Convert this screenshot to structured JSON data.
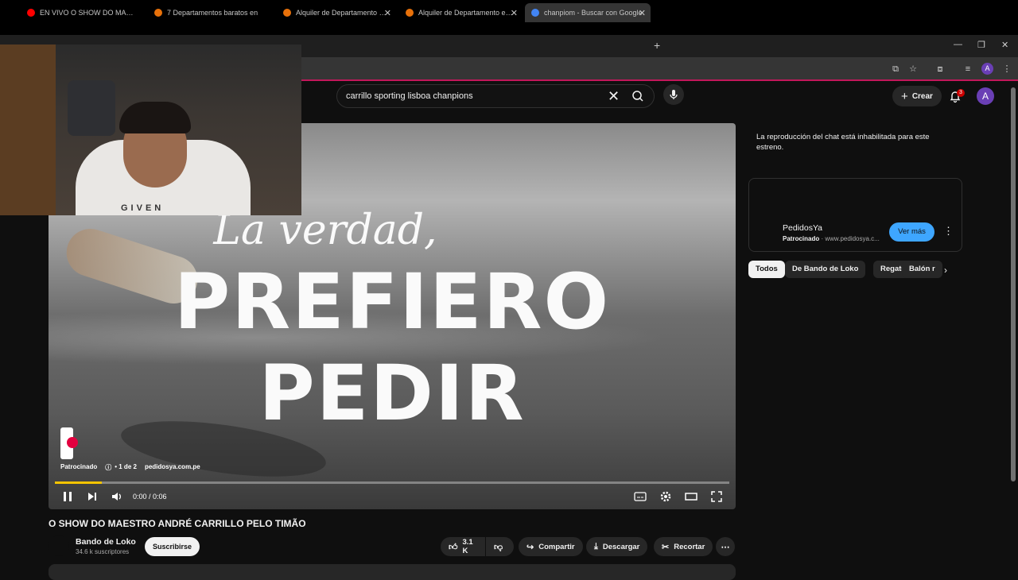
{
  "browser": {
    "tabs": [
      {
        "label": "EN VIVO O SHOW DO MAESTRO",
        "favicon_color": "#ff0000"
      },
      {
        "label": "7 Departamentos baratos en",
        "favicon_color": "#e8710a"
      },
      {
        "label": "Alquiler de Departamento en S",
        "favicon_color": "#e8710a"
      },
      {
        "label": "Alquiler de Departamento en S",
        "favicon_color": "#e8710a"
      },
      {
        "label": "chanpiom - Buscar con Google",
        "favicon_color": "#4285f4"
      }
    ],
    "profile_initial": "A"
  },
  "header": {
    "search_query": "carrillo sporting lisboa chanpions",
    "create_label": "Crear",
    "notification_count": "3",
    "avatar_initial": "A"
  },
  "video": {
    "overlay_line1": "La verdad,",
    "overlay_line2": "PREFIERO",
    "overlay_line3": "PEDIR",
    "ad_label": "Patrocinado",
    "ad_count": "• 1 de 2",
    "ad_domain": "pedidosya.com.pe",
    "time": "0:00 / 0:06",
    "progress": 0.07,
    "progress_color": "#f5c400"
  },
  "webcam": {
    "shirt_text": "GIVEN"
  },
  "meta": {
    "title": "O SHOW DO MAESTRO ANDRÉ CARRILLO PELO TIMÃO",
    "channel_name": "Bando de Loko",
    "subscribers": "34.6 k suscriptores",
    "subscribe_label": "Suscribirse",
    "likes": "3.1 K",
    "share_label": "Compartir",
    "download_label": "Descargar",
    "clip_label": "Recortar"
  },
  "sidebar": {
    "chat_notice": "La reproducción del chat está inhabilitada para este estreno.",
    "ad": {
      "name": "PedidosYa",
      "sponsored": "Patrocinado",
      "domain": "· www.pedidosya.c...",
      "cta": "Ver más"
    },
    "chips": [
      "Todos",
      "De Bando de Loko",
      "Regate",
      "Balón r"
    ]
  }
}
